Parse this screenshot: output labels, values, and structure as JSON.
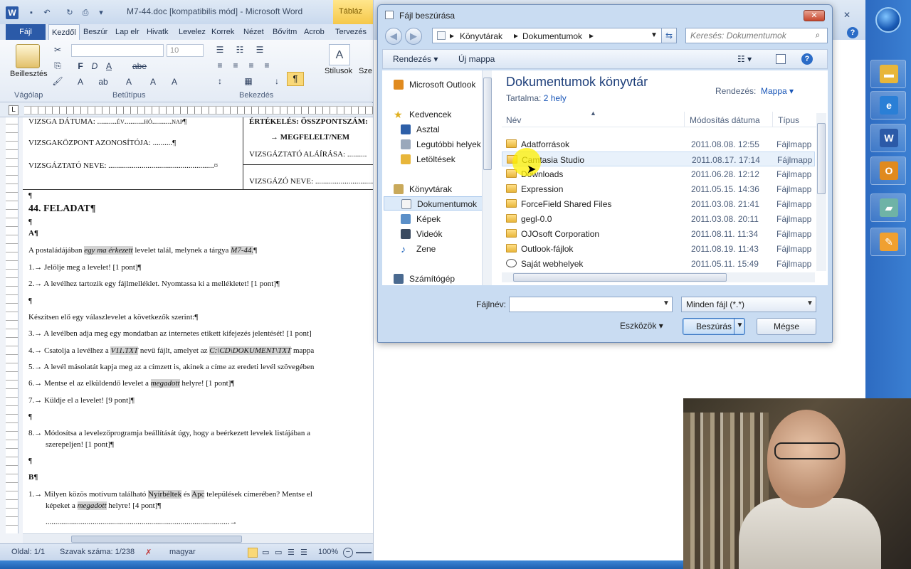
{
  "word": {
    "title": "M7-44.doc [kompatibilis mód]  -  Microsoft Word",
    "context_tab": "Tábláz",
    "app_letter": "W",
    "tabs": [
      {
        "label": "Fájl"
      },
      {
        "label": "Kezdől"
      },
      {
        "label": "Beszúr"
      },
      {
        "label": "Lap elr"
      },
      {
        "label": "Hivatk"
      },
      {
        "label": "Levelez"
      },
      {
        "label": "Korrek"
      },
      {
        "label": "Nézet"
      },
      {
        "label": "Bővítm"
      },
      {
        "label": "Acrob"
      },
      {
        "label": "Tervezés"
      }
    ],
    "ribbon": {
      "paste_label": "Beillesztés",
      "clipboard_group": "Vágólap",
      "font_group": "Betűtípus",
      "paragraph_group": "Bekezdés",
      "styles_label": "Stílusok",
      "styles_cut": "Sze",
      "font_size": "10"
    },
    "document": {
      "table": {
        "exam_date": "VIZSGA DÁTUMA: ..........év..........hó..........nap¶",
        "center_id": "VIZSGAKÖZPONT AZONOSÍTÓJA: ..........¶",
        "examinee_name": "VIZSGÁZTATÓ NEVE: ......................................................¤",
        "right_eval": "ÉRTÉKELÉS: ÖSSZPONTSZÁM:",
        "right_status": "→      MEGFELELT/NEM",
        "right_signature": "VIZSGÁZTATÓ ALÁÍRÁSA: ..........",
        "right_candidate": "VIZSGÁZÓ NEVE: ......................................"
      },
      "lines": {
        "p1": "¶",
        "heading": "44. FELADAT¶",
        "p2": "¶",
        "a": "A¶",
        "intro_pre": "A postaládájában ",
        "intro_hl1": "egy ma érkezett",
        "intro_mid": " levelet talál, melynek a tárgya ",
        "intro_hl2": "M7-44.",
        "intro_end": "¶",
        "t1": "1.→ Jelölje meg a levelet! [1 pont]¶",
        "t2": "2.→ A levélhez tartozik egy fájlmelléklet. Nyomtassa ki a mellékletet! [1 pont]¶",
        "p3": "¶",
        "reply": "Készítsen elő egy válaszlevelet a következők szerint:¶",
        "t3": "3.→ A levélben adja meg egy mondatban az internetes etikett kifejezés jelentését! [1 pont]",
        "t4_pre": "4.→ Csatolja a levélhez a ",
        "t4_hl1": "V11.TXT",
        "t4_mid": " nevű fájlt, amelyet az ",
        "t4_hl2": "C:\\CD\\DOKUMENT\\TXT",
        "t4_end": " mappa",
        "t5": "5.→ A levél másolatát kapja meg az a címzett is, akinek a címe az eredeti levél szövegében",
        "t6_pre": "6.→ Mentse el az elküldendő levelet a ",
        "t6_hl": "megadott",
        "t6_end": " helyre! [1 pont]¶",
        "t7": "7.→ Küldje el a levelet! [9 pont]¶",
        "p4": "¶",
        "t8a": "8.→ Módosítsa a levelezőprogramja beállítását úgy, hogy a beérkezett levelek listájában a",
        "t8b": "szerepeljen! [1 pont]¶",
        "p5": "¶",
        "b": "B¶",
        "b1_pre": "1.→ Milyen közös motívum található ",
        "b1_hl1": "Nyírbéltek",
        "b1_mid": " és ",
        "b1_hl2": "Apc",
        "b1_end": " települések címerében? Mentse el",
        "b1b_pre": "képeket a ",
        "b1b_hl": "megadott",
        "b1b_end": " helyre! [4 pont]¶",
        "dots": "..............................................................................................→"
      }
    },
    "status": {
      "page": "Oldal: 1/1",
      "words": "Szavak száma: 1/238",
      "language": "magyar",
      "zoom": "100%"
    }
  },
  "dialog": {
    "title": "Fájl beszúrása",
    "close": "✕",
    "breadcrumb": [
      "Könyvtárak",
      "Dokumentumok"
    ],
    "search_placeholder": "Keresés: Dokumentumok",
    "toolbar": {
      "organize": "Rendezés",
      "new_folder": "Új mappa"
    },
    "nav": [
      {
        "label": "Microsoft Outlook",
        "icon": "outlook-icon"
      },
      {
        "label": "Kedvencek",
        "icon": "star-icon"
      },
      {
        "label": "Asztal",
        "icon": "desktop-icon"
      },
      {
        "label": "Legutóbbi helyek",
        "icon": "recent-places-icon"
      },
      {
        "label": "Letöltések",
        "icon": "downloads-icon"
      },
      {
        "label": "Könyvtárak",
        "icon": "libraries-icon"
      },
      {
        "label": "Dokumentumok",
        "icon": "documents-icon"
      },
      {
        "label": "Képek",
        "icon": "pictures-icon"
      },
      {
        "label": "Videók",
        "icon": "videos-icon"
      },
      {
        "label": "Zene",
        "icon": "music-icon"
      },
      {
        "label": "Számítógép",
        "icon": "computer-icon"
      }
    ],
    "library": {
      "title": "Dokumentumok könyvtár",
      "contents_label": "Tartalma:",
      "contents_value": "2 hely",
      "arrange_label": "Rendezés:",
      "arrange_value": "Mappa"
    },
    "columns": {
      "name": "Név",
      "modified": "Módosítás dátuma",
      "type": "Típus"
    },
    "files": [
      {
        "name": "Adatforrások",
        "date": "2011.08.08. 12:55",
        "type": "Fájlmapp"
      },
      {
        "name": "Camtasia Studio",
        "date": "2011.08.17. 17:14",
        "type": "Fájlmapp"
      },
      {
        "name": "Downloads",
        "date": "2011.06.28. 12:12",
        "type": "Fájlmapp"
      },
      {
        "name": "Expression",
        "date": "2011.05.15. 14:36",
        "type": "Fájlmapp"
      },
      {
        "name": "ForceField Shared Files",
        "date": "2011.03.08. 21:41",
        "type": "Fájlmapp"
      },
      {
        "name": "gegl-0.0",
        "date": "2011.03.08. 20:11",
        "type": "Fájlmapp"
      },
      {
        "name": "OJOsoft Corporation",
        "date": "2011.08.11. 11:34",
        "type": "Fájlmapp"
      },
      {
        "name": "Outlook-fájlok",
        "date": "2011.08.19. 11:43",
        "type": "Fájlmapp"
      },
      {
        "name": "Saját webhelyek",
        "date": "2011.05.11. 15:49",
        "type": "Fájlmapp"
      }
    ],
    "filename_label": "Fájlnév:",
    "filename_value": "",
    "filter_value": "Minden fájl (*.*)",
    "tools_label": "Eszközök",
    "insert_label": "Beszúrás",
    "cancel_label": "Mégse"
  },
  "colors": {
    "word_blue": "#2b5aa8",
    "dialog_frame": "#c9dcf2",
    "link_blue": "#1a57b8",
    "highlight_yellow": "#fff000"
  }
}
